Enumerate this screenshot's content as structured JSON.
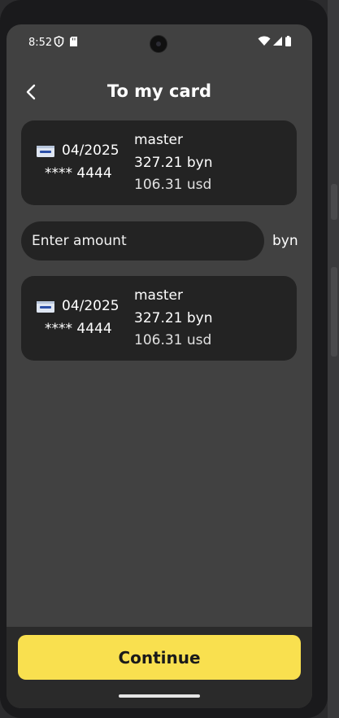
{
  "status_bar": {
    "time": "8:52"
  },
  "header": {
    "title": "To my card"
  },
  "source_card": {
    "expiry": "04/2025",
    "number": "**** 4444",
    "type": "master",
    "balance_byn": "327.21 byn",
    "balance_usd": "106.31 usd"
  },
  "amount": {
    "placeholder": "Enter amount",
    "value": "",
    "currency": "byn"
  },
  "target_card": {
    "expiry": "04/2025",
    "number": "**** 4444",
    "type": "master",
    "balance_byn": "327.21 byn",
    "balance_usd": "106.31 usd"
  },
  "footer": {
    "continue_label": "Continue"
  },
  "icons": {
    "back": "chevron-left-icon",
    "card": "visa-card-icon",
    "status": [
      "vpn-shield-icon",
      "sim-card-icon",
      "wifi-icon",
      "signal-icon",
      "battery-icon"
    ]
  },
  "colors": {
    "accent": "#F9E04F",
    "background": "#414141",
    "card_background": "#232323",
    "text": "#FFFFFF"
  }
}
